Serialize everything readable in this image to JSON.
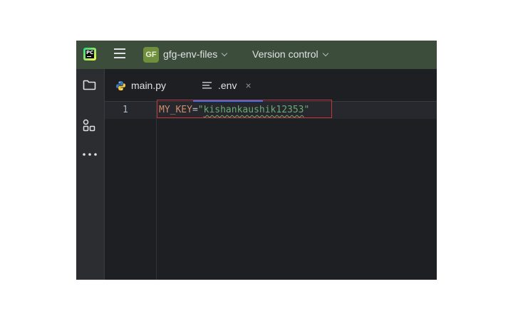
{
  "titlebar": {
    "logo_text": "PC",
    "project_badge": "GF",
    "project_name": "gfg-env-files",
    "version_control": "Version control"
  },
  "sidebar": {
    "icons": [
      "folder-icon",
      "structure-icon",
      "more-icon"
    ]
  },
  "tabs": [
    {
      "label": "main.py",
      "icon": "python-icon",
      "active": false
    },
    {
      "label": ".env",
      "icon": "text-file-icon",
      "active": true,
      "close": "×"
    }
  ],
  "editor": {
    "line_number": "1",
    "code": {
      "key": "MY_KEY",
      "equals": "=",
      "quote_open": "\"",
      "value": "kishankaushik12353",
      "quote_close": "\""
    }
  },
  "colors": {
    "titlebar": "#3c4e3b",
    "background": "#1e1f22",
    "key": "#cf8e6d",
    "string": "#6aab73",
    "highlight": "#c0363a",
    "active_tab": "#3574f0"
  }
}
